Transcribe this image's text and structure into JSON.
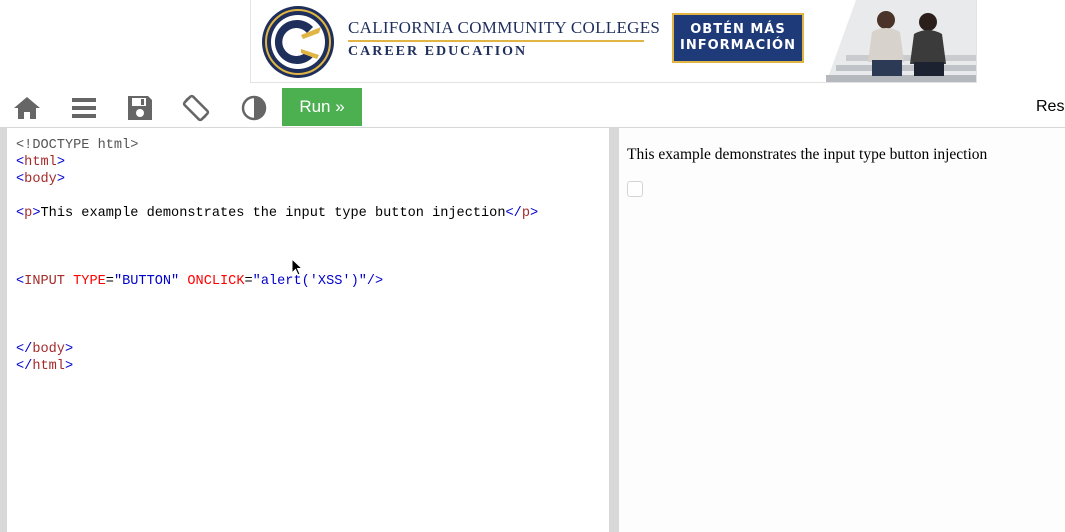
{
  "ad": {
    "org_name": "CALIFORNIA COMMUNITY COLLEGES",
    "sub_name": "CAREER EDUCATION",
    "cta_line1": "OBTÉN MÁS",
    "cta_line2": "INFORMACIÓN",
    "colors": {
      "navy": "#1f3a78",
      "gold": "#e0b543"
    }
  },
  "toolbar": {
    "icons": [
      "home-icon",
      "menu-icon",
      "save-icon",
      "rotate-screen-icon",
      "contrast-icon"
    ],
    "run_label": "Run »",
    "result_label": "Res",
    "run_color": "#4caf50"
  },
  "editor": {
    "lines": [
      {
        "parts": [
          {
            "t": "<!DOCTYPE html>",
            "c": "gray"
          }
        ]
      },
      {
        "parts": [
          {
            "t": "<",
            "c": "blue"
          },
          {
            "t": "html",
            "c": "brown"
          },
          {
            "t": ">",
            "c": "blue"
          }
        ]
      },
      {
        "parts": [
          {
            "t": "<",
            "c": "blue"
          },
          {
            "t": "body",
            "c": "brown"
          },
          {
            "t": ">",
            "c": "blue"
          }
        ]
      },
      {
        "parts": []
      },
      {
        "parts": [
          {
            "t": "<",
            "c": "blue"
          },
          {
            "t": "p",
            "c": "brown"
          },
          {
            "t": ">",
            "c": "blue"
          },
          {
            "t": "This example demonstrates the input type button injection",
            "c": "text"
          },
          {
            "t": "</",
            "c": "blue"
          },
          {
            "t": "p",
            "c": "brown"
          },
          {
            "t": ">",
            "c": "blue"
          }
        ]
      },
      {
        "parts": []
      },
      {
        "parts": []
      },
      {
        "parts": []
      },
      {
        "parts": [
          {
            "t": "<",
            "c": "blue"
          },
          {
            "t": "INPUT",
            "c": "brown"
          },
          {
            "t": " ",
            "c": "text"
          },
          {
            "t": "TYPE",
            "c": "red"
          },
          {
            "t": "=",
            "c": "text"
          },
          {
            "t": "\"BUTTON\"",
            "c": "val"
          },
          {
            "t": " ",
            "c": "text"
          },
          {
            "t": "ONCLICK",
            "c": "red"
          },
          {
            "t": "=",
            "c": "text"
          },
          {
            "t": "\"alert('XSS')\"",
            "c": "val"
          },
          {
            "t": "/>",
            "c": "blue"
          }
        ]
      },
      {
        "parts": []
      },
      {
        "parts": []
      },
      {
        "parts": []
      },
      {
        "parts": [
          {
            "t": "</",
            "c": "blue"
          },
          {
            "t": "body",
            "c": "brown"
          },
          {
            "t": ">",
            "c": "blue"
          }
        ]
      },
      {
        "parts": [
          {
            "t": "</",
            "c": "blue"
          },
          {
            "t": "html",
            "c": "brown"
          },
          {
            "t": ">",
            "c": "blue"
          }
        ]
      }
    ]
  },
  "result": {
    "paragraph": "This example demonstrates the input type button injection"
  }
}
